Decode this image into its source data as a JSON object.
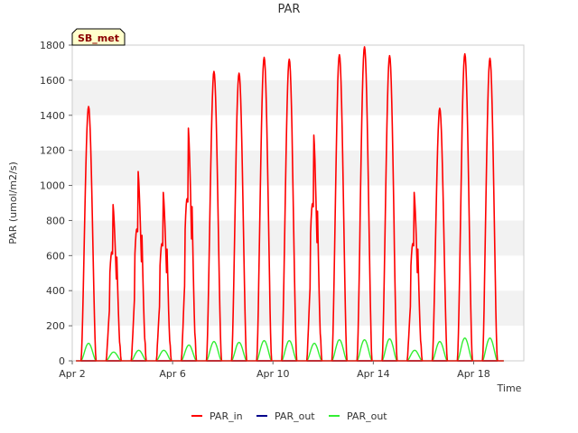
{
  "chart_data": {
    "type": "line",
    "title": "PAR",
    "xlabel": "Time",
    "ylabel": "PAR (umol/m2/s)",
    "site_badge": "SB_met",
    "x_ticks": [
      "Apr 2",
      "Apr 6",
      "Apr 10",
      "Apr 14",
      "Apr 18"
    ],
    "x_tick_days": [
      2,
      6,
      10,
      14,
      18
    ],
    "xlim": [
      2,
      20
    ],
    "ylim": [
      0,
      1800
    ],
    "y_ticks": [
      0,
      200,
      400,
      600,
      800,
      1000,
      1200,
      1400,
      1600,
      1800
    ],
    "grid": "horizontal bands",
    "legend_position": "bottom",
    "series": [
      {
        "name": "PAR_in",
        "color": "#ff0000",
        "daily_peak": [
          1450,
          900,
          1090,
          970,
          1340,
          1650,
          1640,
          1730,
          1720,
          1300,
          1745,
          1790,
          1740,
          970,
          1440,
          1750,
          1725
        ]
      },
      {
        "name": "PAR_out",
        "color": "#00008b",
        "daily_peak": [
          0,
          0,
          0,
          0,
          0,
          0,
          0,
          0,
          0,
          0,
          0,
          0,
          0,
          0,
          0,
          0,
          0
        ]
      },
      {
        "name": "PAR_out",
        "color": "#33ee33",
        "daily_peak": [
          100,
          50,
          60,
          60,
          90,
          110,
          105,
          115,
          115,
          100,
          120,
          120,
          125,
          60,
          110,
          130,
          130
        ]
      }
    ],
    "day_centers": [
      2.65,
      3.65,
      4.65,
      5.65,
      6.65,
      7.65,
      8.65,
      9.65,
      10.65,
      11.65,
      12.65,
      13.65,
      14.65,
      15.65,
      16.65,
      17.65,
      18.65
    ]
  }
}
